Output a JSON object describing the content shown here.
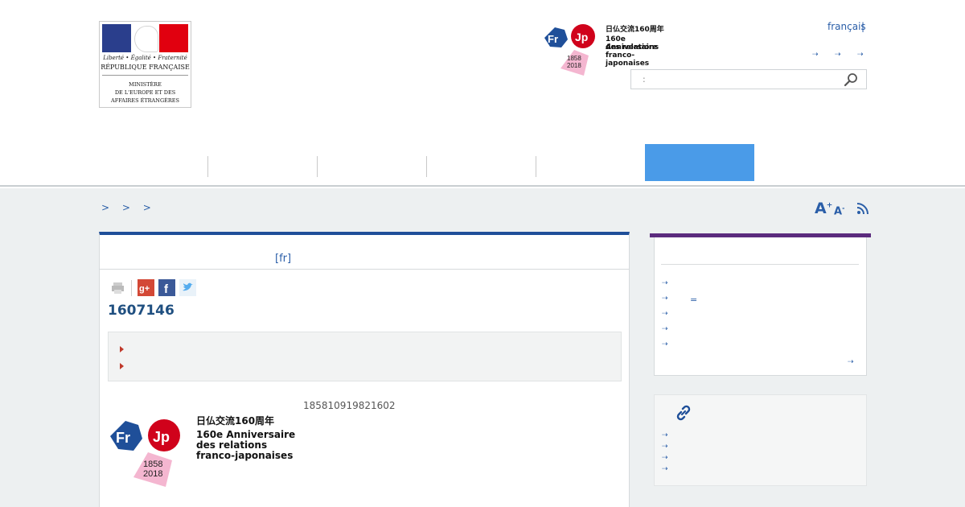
{
  "header": {
    "logo": {
      "motto": "Liberté • Égalité • Fraternité",
      "republic": "RÉPUBLIQUE FRANÇAISE",
      "ministry_lines": [
        "MINISTÈRE",
        "DE L'EUROPE ET DES",
        "AFFAIRES ÉTRANGÈRES"
      ]
    },
    "anniversary_logo": {
      "fr": "Fr",
      "jp": "Jp",
      "years": [
        "1858",
        "2018"
      ],
      "lines": [
        "日仏交流160周年",
        "160e Anniversaire",
        "des relations",
        "franco-japonaises"
      ]
    },
    "language": "français",
    "language_separator": "|",
    "quick_links": [
      "⇢",
      "⇢",
      "⇢"
    ],
    "search": {
      "placeholder": ":",
      "icon": "search-icon"
    }
  },
  "nav": {
    "active_color": "#4a9be8"
  },
  "breadcrumb": "> > >",
  "tools": {
    "font_increase": "A",
    "plus": "+",
    "font_decrease": "A",
    "minus": "-",
    "rss_icon": "rss-icon"
  },
  "article": {
    "subtitle": "[fr]",
    "share_icons": [
      "print-icon",
      "google-plus-icon",
      "facebook-icon",
      "twitter-icon"
    ],
    "code": "1607146",
    "dates": "185810919821602",
    "anniversary_logo": {
      "fr": "Fr",
      "jp": "Jp",
      "years": [
        "1858",
        "2018"
      ],
      "lines": [
        "日仏交流160周年",
        "160e Anniversaire",
        "des relations",
        "franco-japonaises"
      ]
    }
  },
  "aside": {
    "list_arrows": [
      "⇢",
      "⇢",
      "⇢",
      "⇢",
      "⇢"
    ],
    "equals": "=",
    "more": "⇢",
    "links_icon": "link-icon",
    "links_arrows": [
      "⇢",
      "⇢",
      "⇢",
      "⇢"
    ]
  },
  "colors": {
    "brand_blue": "#1f4f99",
    "accent_purple": "#5b2b7e",
    "link_blue": "#2a5ea8"
  }
}
